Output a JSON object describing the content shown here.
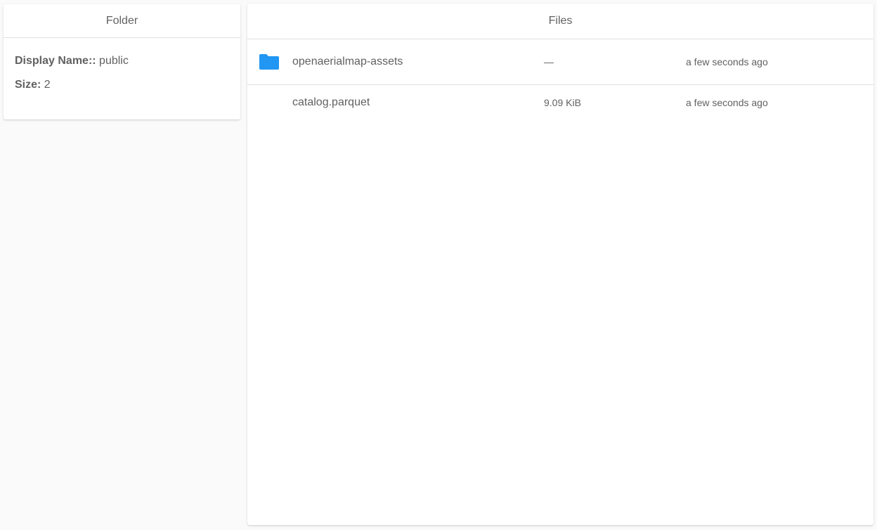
{
  "folder_panel": {
    "title": "Folder",
    "display_name_label": "Display Name::",
    "display_name_value": "public",
    "size_label": "Size:",
    "size_value": "2"
  },
  "files_panel": {
    "title": "Files",
    "rows": [
      {
        "name": "openaerialmap-assets",
        "size": "—",
        "modified": "a few seconds ago",
        "icon": "folder-icon",
        "icon_color": "#2196f3"
      },
      {
        "name": "catalog.parquet",
        "size": "9.09 KiB",
        "modified": "a few seconds ago",
        "icon": ""
      }
    ]
  }
}
